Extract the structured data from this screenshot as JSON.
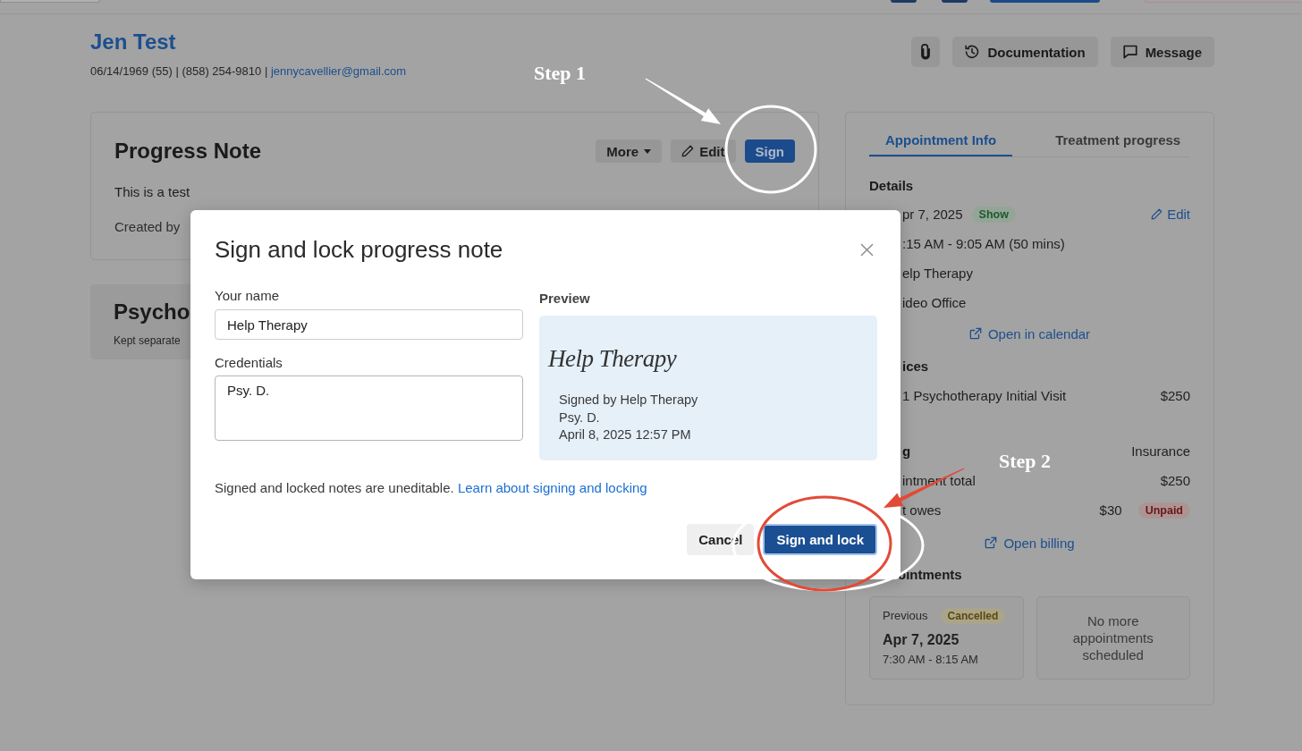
{
  "client": {
    "name": "Jen Test",
    "details": "06/14/1969 (55) | (858) 254-9810 |",
    "email": "jennycavellier@gmail.com"
  },
  "header_actions": [
    {
      "kind": "attach"
    },
    {
      "kind": "history",
      "label": "Documentation"
    },
    {
      "kind": "message",
      "label": "Message"
    }
  ],
  "progress_note": {
    "title": "Progress Note",
    "actions": [
      {
        "kind": "menu",
        "label": "More"
      },
      {
        "kind": "edit",
        "label": "Edit"
      },
      {
        "kind": "primary",
        "label": "Sign"
      }
    ],
    "body": "This is a test",
    "created_by": "Created by"
  },
  "psychotherapy_notes": {
    "title": "Psycho",
    "subtitle": "Kept separate"
  },
  "side_panel": {
    "tabs": [
      {
        "label": "Appointment Info",
        "selected": true
      },
      {
        "label": "Treatment progress",
        "selected": false
      }
    ],
    "details": {
      "heading": "Details",
      "date": "pr 7, 2025",
      "status": "Show",
      "edit_link": "Edit",
      "time": ":15 AM - 9:05 AM (50 mins)",
      "provider": "elp Therapy",
      "location": "ideo Office",
      "calendar_link": "Open in calendar"
    },
    "services": {
      "heading": "ices",
      "items": [
        {
          "name": "1 Psychotherapy Initial Visit",
          "price": "$250"
        }
      ]
    },
    "billing": {
      "heading": "g",
      "payer": "Insurance",
      "total_label": "intment total",
      "total": "$250",
      "owes_label": "t owes",
      "owes": "$30",
      "owes_status": "Unpaid",
      "link": "Open billing"
    },
    "appointments": {
      "heading": "ointments",
      "previous": {
        "label": "Previous",
        "status": "Cancelled",
        "date": "Apr 7, 2025",
        "time": "7:30 AM - 8:15 AM"
      },
      "next": "No more appointments scheduled"
    }
  },
  "modal": {
    "title": "Sign and lock progress note",
    "name_field": {
      "label": "Your name",
      "value": "Help Therapy"
    },
    "credentials_field": {
      "label": "Credentials",
      "value": "Psy. D."
    },
    "preview": {
      "label": "Preview",
      "signature": "Help Therapy",
      "lines": [
        "Signed by Help Therapy",
        "Psy. D.",
        "April 8, 2025 12:57 PM"
      ]
    },
    "notice": "Signed and locked notes are uneditable.",
    "notice_link": "Learn about signing and locking",
    "buttons": [
      {
        "kind": "secondary",
        "label": "Cancel"
      },
      {
        "kind": "primary",
        "label": "Sign and lock"
      }
    ]
  },
  "annotations": [
    {
      "label": "Step 1",
      "color": "#ffffff"
    },
    {
      "label": "Step 2",
      "color": "#e24a38"
    }
  ]
}
